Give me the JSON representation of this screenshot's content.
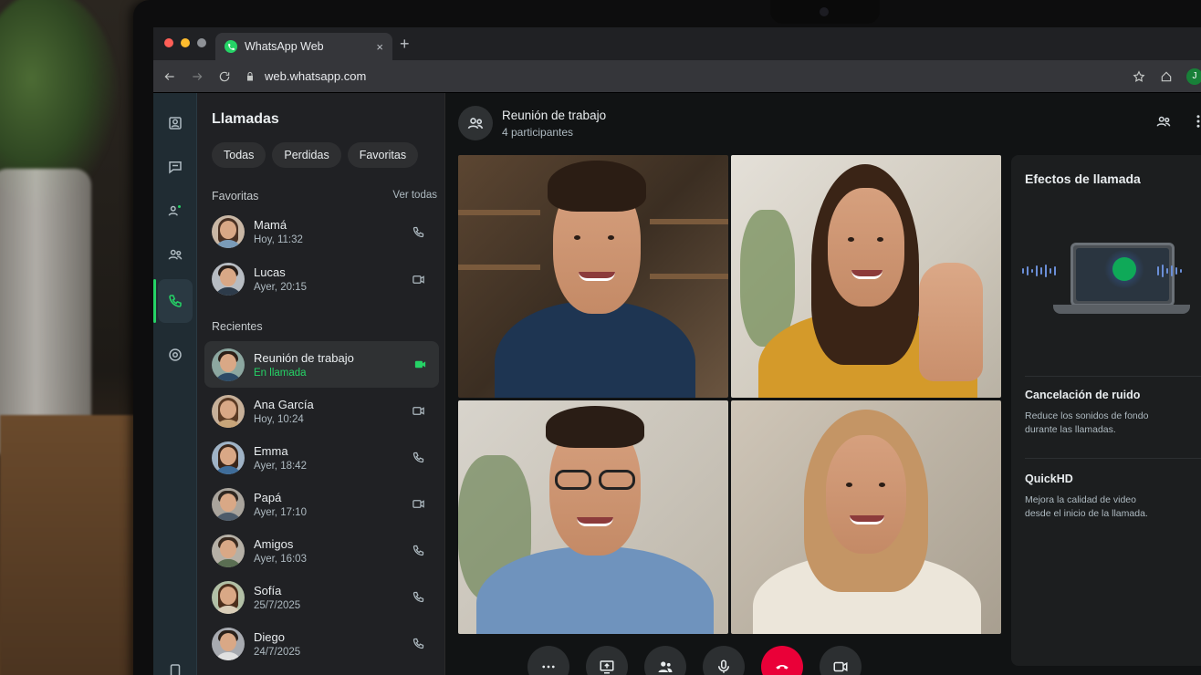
{
  "browser": {
    "tab_title": "WhatsApp Web",
    "tab_close": "×",
    "new_tab": "+",
    "url": "web.whatsapp.com",
    "profile_initial": "J"
  },
  "panel": {
    "title": "Llamadas",
    "chips": [
      "Todas",
      "Perdidas",
      "Favoritas"
    ],
    "favorites_heading": "Favoritas",
    "see_all": "Ver todas",
    "recents_heading": "Recientes"
  },
  "favorites": [
    {
      "name": "Mamá",
      "time": "Hoy, 11:32",
      "icon": "phone-icon"
    },
    {
      "name": "Lucas",
      "time": "Ayer, 20:15",
      "icon": "video-icon"
    }
  ],
  "recents": [
    {
      "name": "Reunión de trabajo",
      "time": "En llamada",
      "icon": "video-icon",
      "active": true
    },
    {
      "name": "Ana García",
      "time": "Hoy, 10:24",
      "icon": "video-icon"
    },
    {
      "name": "Emma",
      "time": "Ayer, 18:42",
      "icon": "phone-icon"
    },
    {
      "name": "Papá",
      "time": "Ayer, 17:10",
      "icon": "video-icon"
    },
    {
      "name": "Amigos",
      "time": "Ayer, 16:03",
      "icon": "phone-icon"
    },
    {
      "name": "Sofía",
      "time": "25/7/2025",
      "icon": "phone-icon"
    },
    {
      "name": "Diego",
      "time": "24/7/2025",
      "icon": "phone-icon"
    }
  ],
  "call": {
    "title": "Reunión de trabajo",
    "subtitle": "4 participantes"
  },
  "effects": {
    "title": "Efectos de llamada",
    "noise": {
      "title": "Cancelación de ruido",
      "desc": "Reduce los sonidos de fondo durante las llamadas.",
      "enabled": true
    },
    "quickhd": {
      "title": "QuickHD",
      "desc": "Mejora la calidad de video desde el inicio de la llamada.",
      "enabled": true
    }
  },
  "controls": [
    "more-icon",
    "screen-share-icon",
    "participants-icon",
    "mic-icon",
    "end-call-icon",
    "video-icon"
  ],
  "colors": {
    "accent": "#25d366",
    "end_call": "#ea0038",
    "background": "#111b21"
  }
}
